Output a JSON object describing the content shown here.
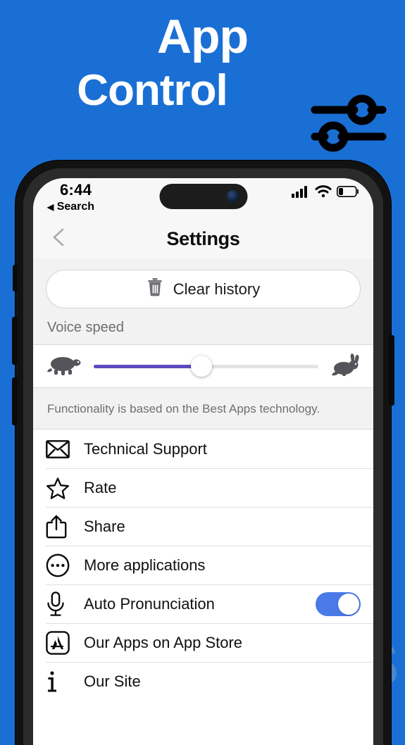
{
  "theme": {
    "brand_blue": "#1a6fd4",
    "slider_purple": "#5b4bbd",
    "toggle_on_blue": "#4a7ae8",
    "screen_bg": "#f2f2f3"
  },
  "hero": {
    "title": "App",
    "subtitle": "Control",
    "icon": "sliders-icon"
  },
  "watermark": {
    "text": "IS"
  },
  "phone": {
    "status_bar": {
      "time": "6:44",
      "back_label": "Search",
      "back_arrow": "◀",
      "signal_icon": "cellular-signal-icon",
      "wifi_icon": "wifi-icon",
      "battery_icon": "battery-low-icon"
    },
    "nav_bar": {
      "back_icon": "chevron-left-icon",
      "title": "Settings"
    },
    "clear_history": {
      "icon": "trash-icon",
      "label": "Clear history"
    },
    "voice_speed": {
      "section_label": "Voice speed",
      "left_icon": "turtle-icon",
      "right_icon": "rabbit-icon",
      "value_percent": 48
    },
    "footer_note": "Functionality is based on the Best Apps technology.",
    "list_items": [
      {
        "icon": "envelope-icon",
        "label": "Technical Support",
        "toggle": null
      },
      {
        "icon": "star-icon",
        "label": "Rate",
        "toggle": null
      },
      {
        "icon": "share-icon",
        "label": "Share",
        "toggle": null
      },
      {
        "icon": "ellipsis-circle-icon",
        "label": "More applications",
        "toggle": null
      },
      {
        "icon": "microphone-icon",
        "label": "Auto Pronunciation",
        "toggle": "on"
      },
      {
        "icon": "app-store-icon",
        "label": "Our Apps on App Store",
        "toggle": null
      },
      {
        "icon": "info-icon",
        "label": "Our Site",
        "toggle": null
      }
    ]
  }
}
